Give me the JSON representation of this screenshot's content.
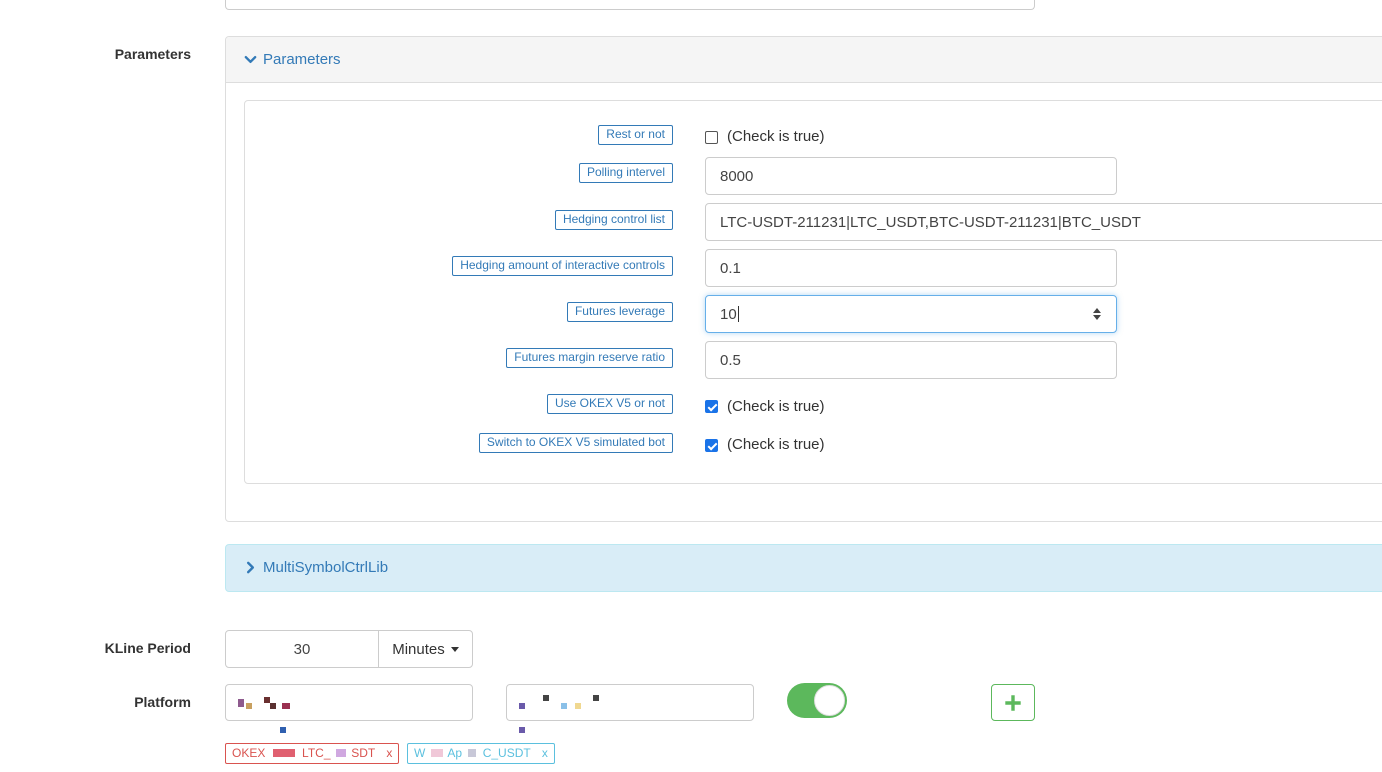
{
  "form": {
    "parameters_label": "Parameters",
    "kline_label": "KLine Period",
    "platform_label": "Platform"
  },
  "parameters_panel": {
    "title": "Parameters",
    "fields": {
      "rest": {
        "label": "Rest or not",
        "checked": false,
        "hint": "(Check is true)"
      },
      "polling": {
        "label": "Polling intervel",
        "value": "8000"
      },
      "hedge_list": {
        "label": "Hedging control list",
        "value": "LTC-USDT-211231|LTC_USDT,BTC-USDT-211231|BTC_USDT"
      },
      "hedge_amount": {
        "label": "Hedging amount of interactive controls",
        "value": "0.1"
      },
      "leverage": {
        "label": "Futures leverage",
        "value": "10"
      },
      "margin_ratio": {
        "label": "Futures margin reserve ratio",
        "value": "0.5"
      },
      "okex_v5": {
        "label": "Use OKEX V5 or not",
        "checked": true,
        "hint": "(Check is true)"
      },
      "okex_sim": {
        "label": "Switch to OKEX V5 simulated bot",
        "checked": true,
        "hint": "(Check is true)"
      }
    }
  },
  "multi_panel": {
    "title": "MultiSymbolCtrlLib"
  },
  "kline": {
    "value": "30",
    "unit": "Minutes"
  },
  "platform": {
    "toggle_on": true,
    "add_icon": "plus-icon",
    "pairs": [
      {
        "text": "OKEX",
        "text2": "LTC_",
        "text3": "SDT",
        "remove": "x",
        "color": "#d9534f"
      },
      {
        "text": "W",
        "text2": "Ap",
        "text3": "C_USDT",
        "remove": "x",
        "color": "#5bc0de"
      }
    ]
  },
  "colors": {
    "link": "#337ab7",
    "success": "#5cb85c",
    "danger": "#d9534f",
    "info": "#5bc0de",
    "checkbox": "#1a73e8"
  }
}
